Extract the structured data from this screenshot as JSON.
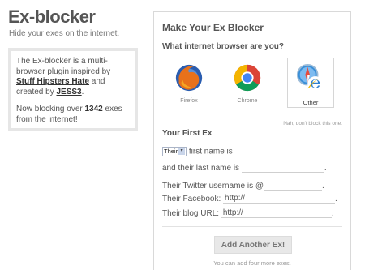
{
  "brand": {
    "title": "Ex-blocker",
    "tagline": "Hide your exes on the internet."
  },
  "info": {
    "intro_prefix": "The Ex-blocker is a multi-browser plugin inspired by ",
    "inspired_link": "Stuff Hipsters Hate",
    "intro_middle": " and created by ",
    "creator_link": "JESS3",
    "intro_suffix": ".",
    "count_prefix": "Now blocking over ",
    "count_value": "1342",
    "count_suffix": " exes from the internet!"
  },
  "form": {
    "title": "Make Your Ex Blocker",
    "browser_question": "What internet browser are you?",
    "browsers": [
      {
        "label": "Firefox",
        "icon": "firefox-icon",
        "selected": false
      },
      {
        "label": "Chrome",
        "icon": "chrome-icon",
        "selected": false
      },
      {
        "label": "Other",
        "icon": "safari-ie-icon",
        "selected": true
      }
    ],
    "nah_link": "Nah, don't block this one.",
    "section_title": "Your First Ex",
    "pronoun_value": "Their",
    "first_name_label": " first name is",
    "last_name_label": "and their last name is",
    "twitter_label": "Their Twitter username is @",
    "facebook_label": "Their Facebook:",
    "facebook_value": "http://",
    "blog_label": "Their blog URL:",
    "blog_value": "http://",
    "period": ".",
    "add_button": "Add Another Ex!",
    "remaining_text": "You can add four more exes."
  },
  "colors": {
    "accent_blue": "#1f6fc0",
    "text": "#555555",
    "border": "#d9d9d9"
  }
}
